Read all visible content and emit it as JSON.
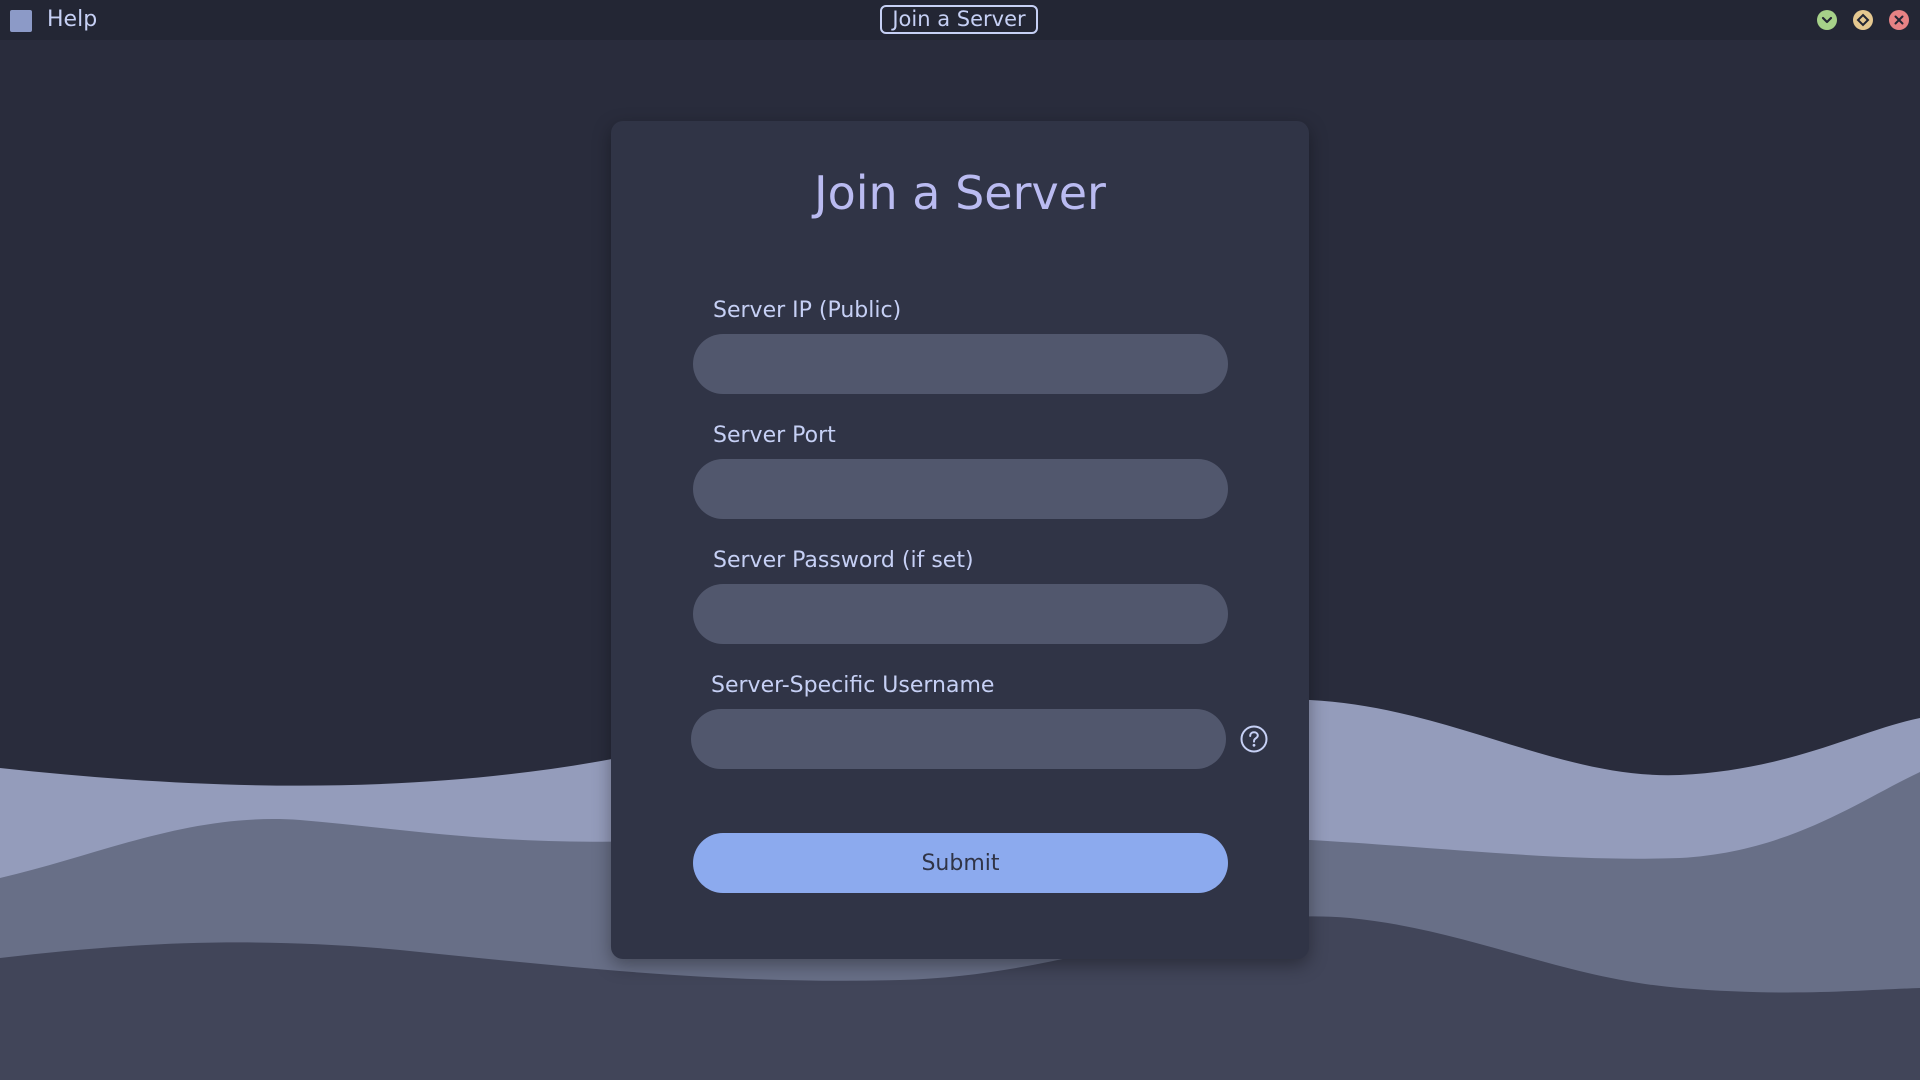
{
  "titlebar": {
    "menu_help": "Help",
    "window_title": "Join a Server",
    "icons": {
      "app": "app-square-icon",
      "minimize": "chevron-down-icon",
      "maximize": "diamond-icon",
      "close": "close-icon"
    }
  },
  "form": {
    "title": "Join a Server",
    "fields": [
      {
        "label": "Server IP (Public)",
        "value": "",
        "placeholder": ""
      },
      {
        "label": "Server Port",
        "value": "",
        "placeholder": ""
      },
      {
        "label": "Server Password (if set)",
        "value": "",
        "placeholder": ""
      },
      {
        "label": "Server-Specific Username",
        "value": "",
        "placeholder": ""
      }
    ],
    "help_icon": "question-circle-icon",
    "submit_label": "Submit"
  },
  "colors": {
    "background": "#292c3c",
    "titlebar": "#232634",
    "card": "#303446",
    "input": "#51576d",
    "accent": "#8caaee",
    "title_text": "#babbf1",
    "label_text": "#c6d0f5",
    "wave_light": "#949cbb",
    "wave_mid": "#686f87",
    "wave_dark": "#414559",
    "minimize": "#a6d189",
    "maximize": "#e5c890",
    "close": "#e78284"
  }
}
